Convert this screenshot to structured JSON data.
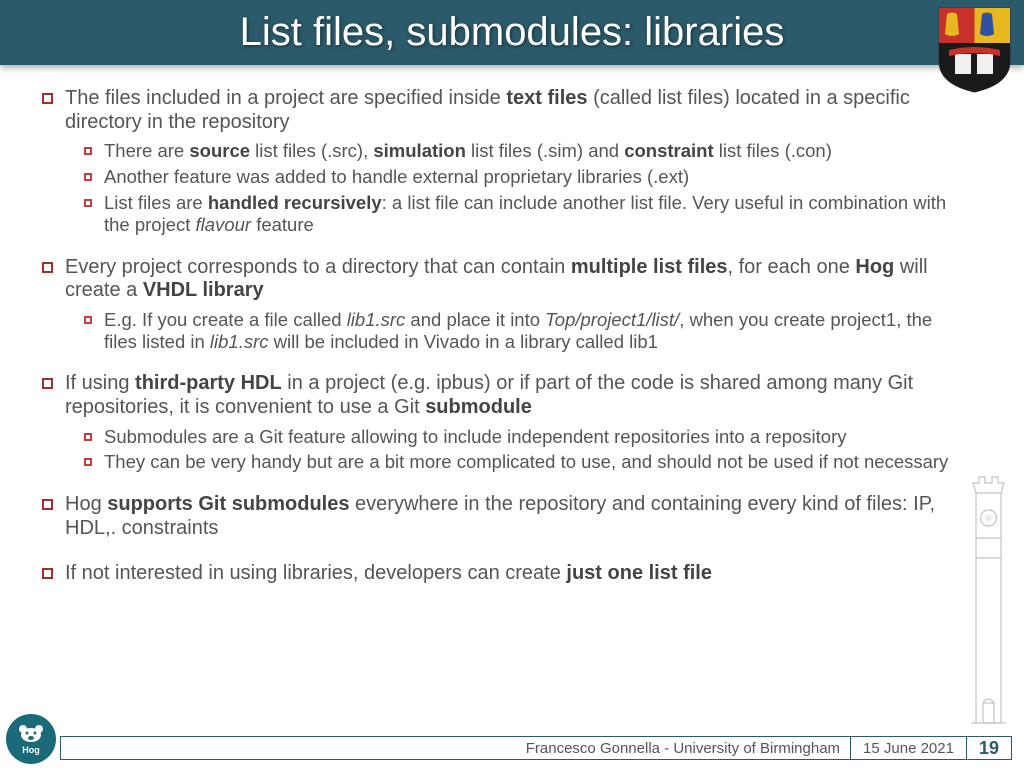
{
  "title": "List files, submodules: libraries",
  "bullets": {
    "b1": "The files included in a project are specified inside <b>text files</b> (called list files) located in a specific directory in the repository",
    "b1a": "There are <b>source</b> list files (.src), <b>simulation</b> list files (.sim) and <b>constraint</b> list files (.con)",
    "b1b": "Another feature was added to handle external proprietary libraries (.ext)",
    "b1c": "List files are <b>handled recursively</b>: a list file can include another list file. Very useful in combination with the project <i>flavour</i> feature",
    "b2": "Every project corresponds to a directory that can contain <b>multiple list files</b>, for each one <b>Hog</b> will create a <b>VHDL library</b>",
    "b2a": "E.g. If you create a file called <i>lib1.src</i> and place it into <i>Top/project1/list/</i>, when you create project1, the files listed in <i>lib1.src</i> will be included in Vivado in a library called lib1",
    "b3": "If using <b>third-party HDL</b> in a project (e.g. ipbus) or if part of the code is shared among many Git repositories, it is convenient to use a Git <b>submodule</b>",
    "b3a": "Submodules are a Git feature allowing to include independent repositories into a repository",
    "b3b": "They can be very handy but are a bit more complicated to use, and should not be used if not necessary",
    "b4": "Hog <b>supports Git submodules</b> everywhere in the repository and containing every kind of files: IP, HDL,. constraints",
    "b5": "If not interested in using libraries, developers can create <b>just one list file</b>"
  },
  "footer": {
    "author": "Francesco Gonnella - University of Birmingham",
    "date": "15 June 2021",
    "page": "19"
  },
  "hog_label": "Hog"
}
